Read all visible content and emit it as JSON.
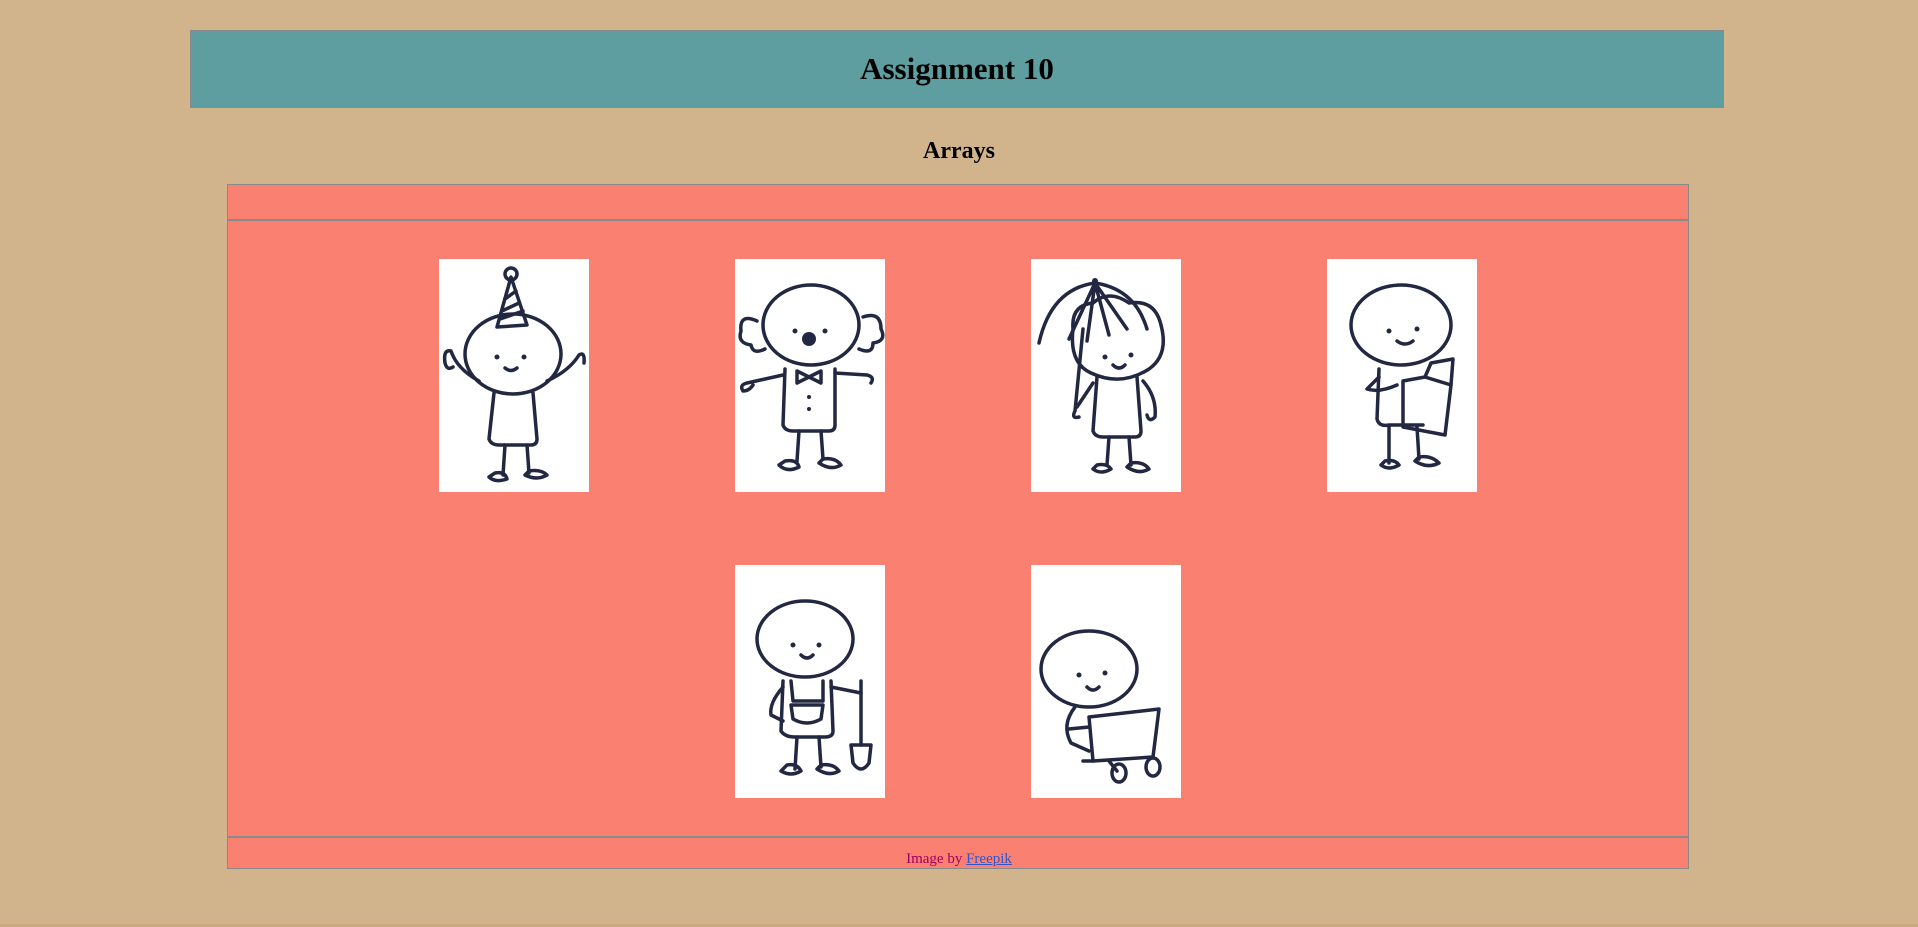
{
  "header": {
    "title": "Assignment 10"
  },
  "subtitle": "Arrays",
  "gallery": {
    "images": [
      {
        "icon": "party-hat-stick-figure"
      },
      {
        "icon": "clown-stick-figure"
      },
      {
        "icon": "umbrella-stick-figure"
      },
      {
        "icon": "reading-stick-figure"
      },
      {
        "icon": "gardener-shovel-stick-figure"
      },
      {
        "icon": "laptop-stick-figure"
      }
    ]
  },
  "footer": {
    "credit_prefix": "Image by",
    "credit_link": "Freepik"
  },
  "colors": {
    "page_background": "#d2b48c",
    "header_background": "#5f9ea0",
    "panel_background": "#fa8072"
  }
}
